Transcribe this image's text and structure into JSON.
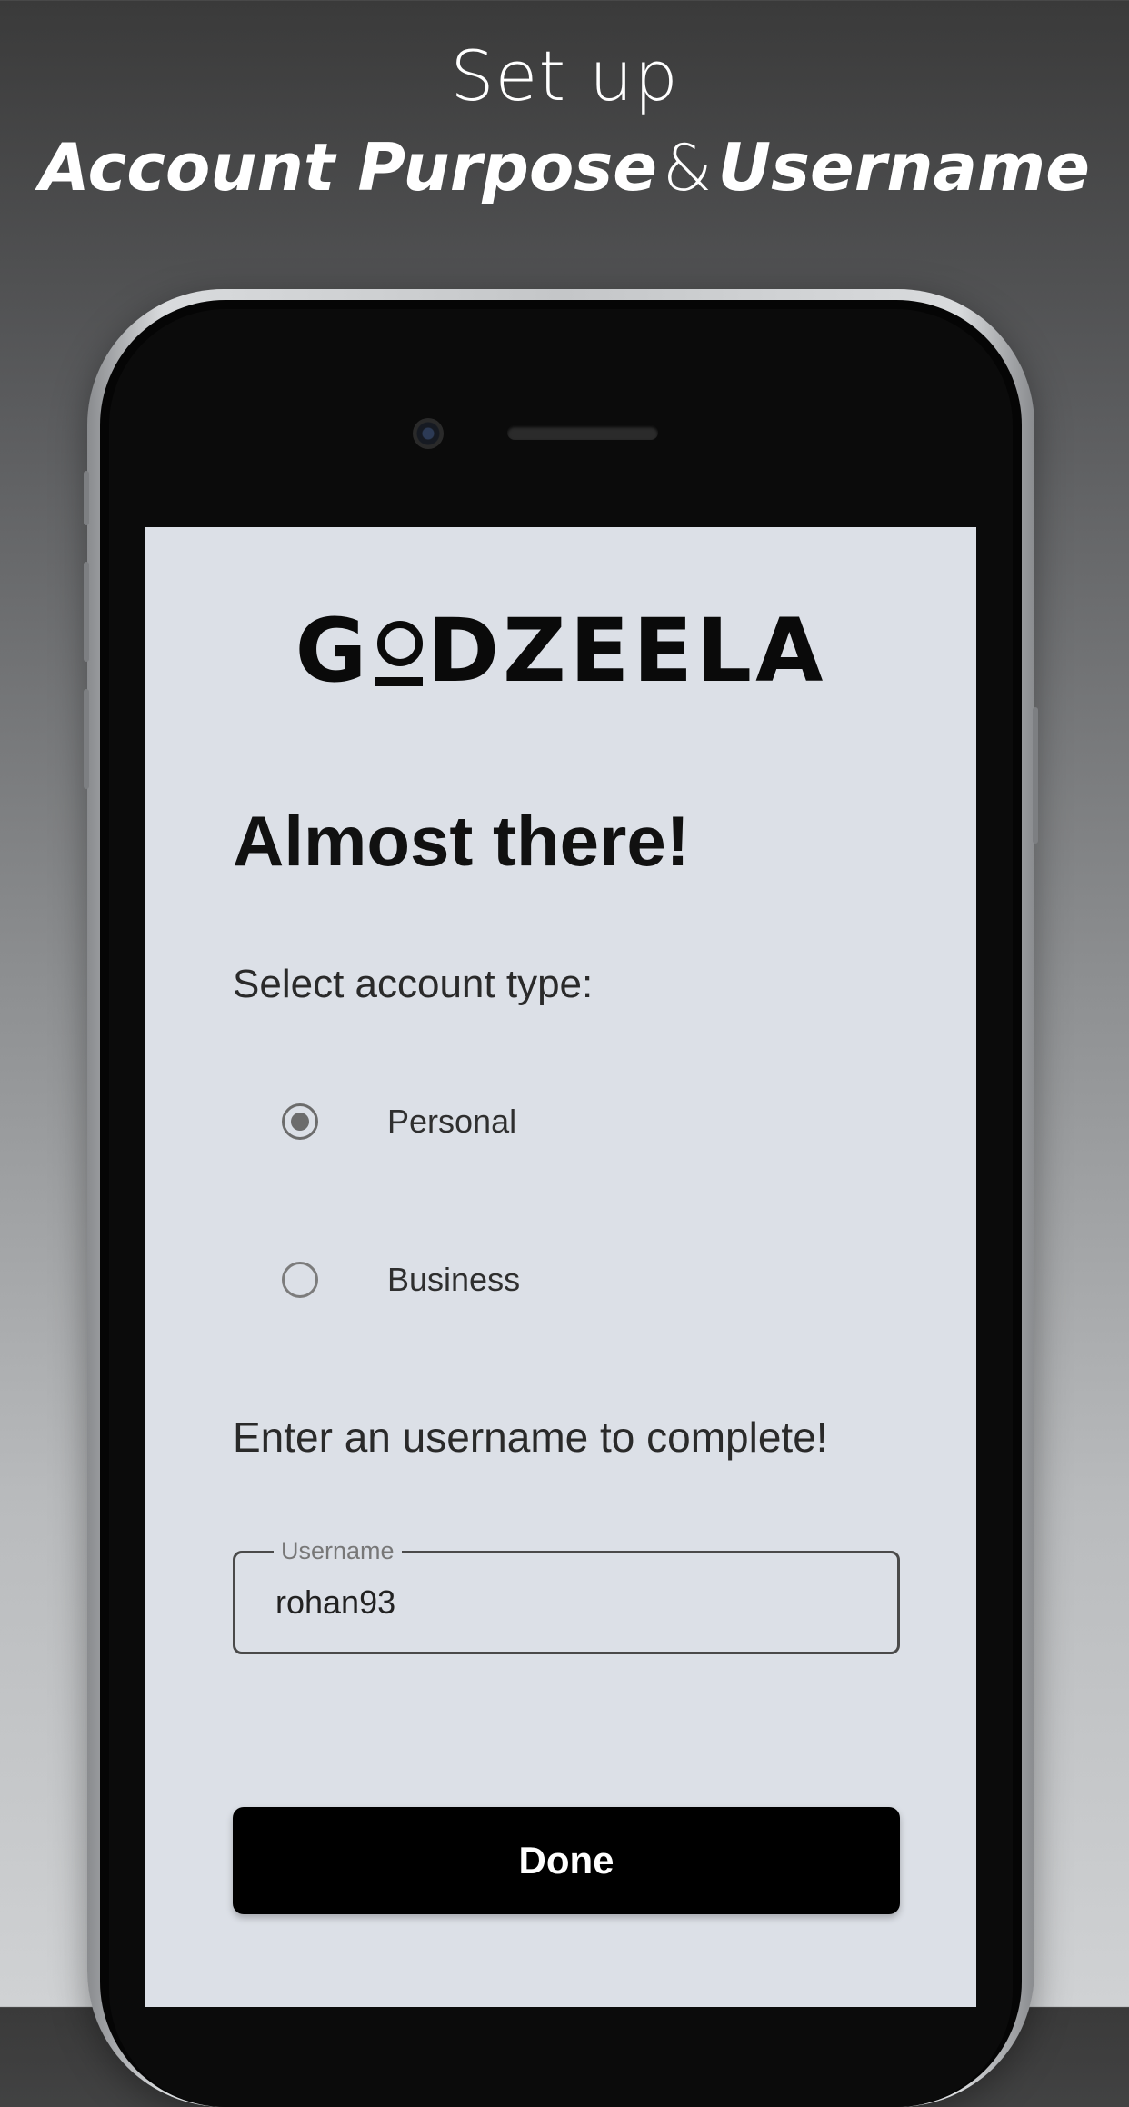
{
  "headline": {
    "line1": "Set up",
    "part1": "Account Purpose",
    "amp": "&",
    "part2": "Username"
  },
  "app": {
    "logo_prefix": "G",
    "logo_suffix": "DZEELA",
    "title": "Almost there!",
    "account_type_label": "Select account type:",
    "options": [
      {
        "label": "Personal",
        "selected": true
      },
      {
        "label": "Business",
        "selected": false
      }
    ],
    "username_prompt": "Enter an username to complete!",
    "username_field": {
      "label": "Username",
      "value": "rohan93"
    },
    "done_label": "Done"
  }
}
